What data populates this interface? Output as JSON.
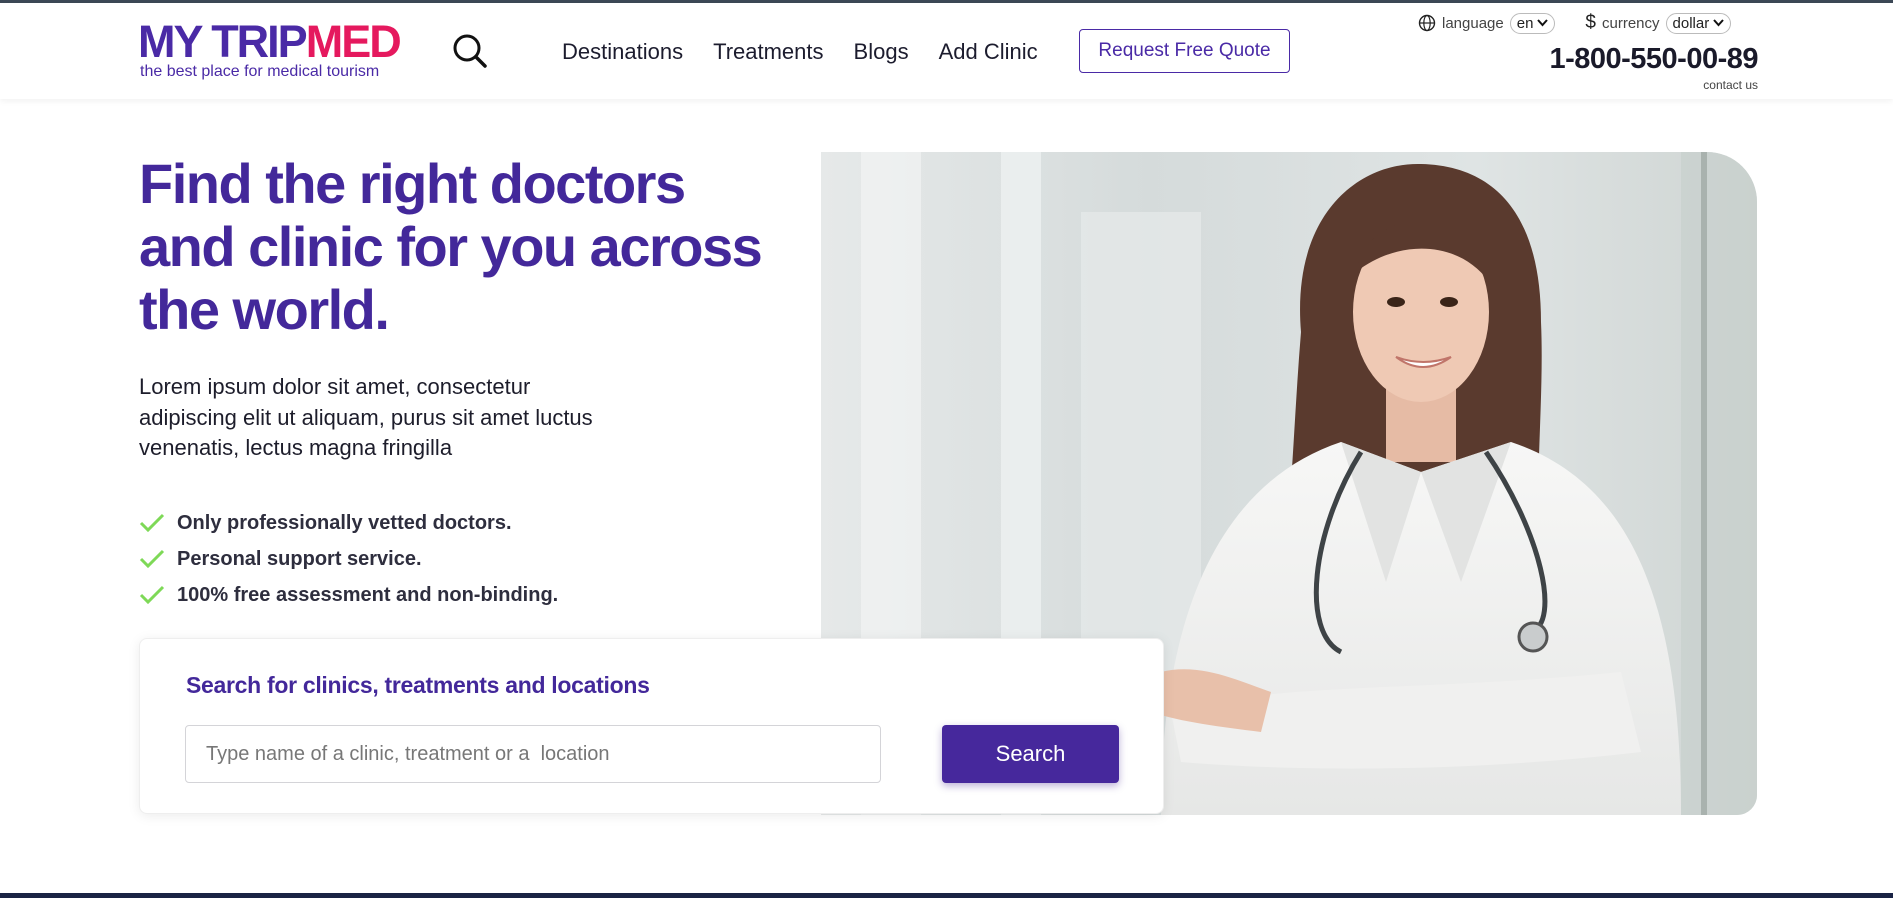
{
  "header": {
    "logo": {
      "part1": "MY TRIP",
      "part2": "MED",
      "tagline": "the best place for medical tourism"
    },
    "search_icon": "search-icon",
    "nav": [
      "Destinations",
      "Treatments",
      "Blogs",
      "Add Clinic"
    ],
    "quote_button": "Request Free Quote",
    "language_label": "language",
    "language_value": "en",
    "currency_label": "currency",
    "currency_value": "dollar",
    "phone": "1-800-550-00-89",
    "contact_link": "contact us"
  },
  "hero": {
    "title": "Find the right doctors and clinic for you across the world.",
    "text": "Lorem ipsum dolor sit amet, consectetur adipiscing elit ut aliquam, purus sit amet luctus venenatis, lectus magna fringilla",
    "features": [
      "Only professionally vetted doctors.",
      "Personal support service.",
      "100% free assessment and non-binding."
    ]
  },
  "search": {
    "heading": "Search for clinics, treatments and locations",
    "placeholder": "Type name of a clinic, treatment or a  location",
    "button": "Search"
  },
  "colors": {
    "brand_purple": "#43289a",
    "brand_pink": "#e5195e",
    "check_green": "#7ed957"
  }
}
